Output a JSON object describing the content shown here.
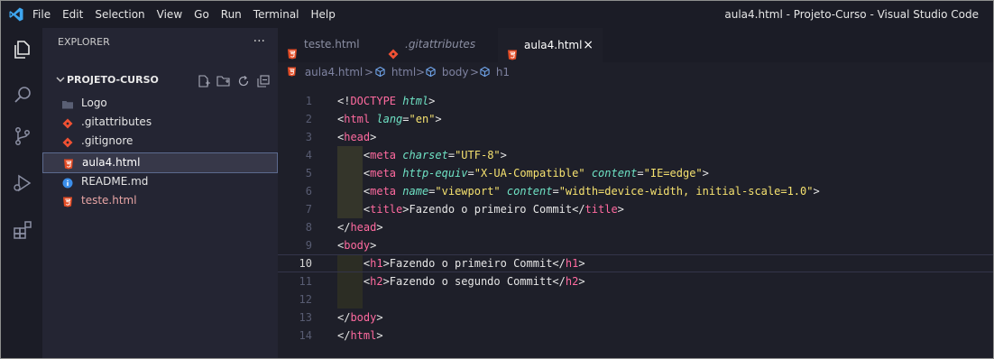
{
  "menu": [
    "File",
    "Edit",
    "Selection",
    "View",
    "Go",
    "Run",
    "Terminal",
    "Help"
  ],
  "window_title": "aula4.html - Projeto-Curso - Visual Studio Code",
  "explorer": {
    "title": "EXPLORER",
    "more": "···",
    "folder": "PROJETO-CURSO",
    "files": [
      {
        "name": "Logo",
        "icon": "folder-icon",
        "color": "#e6e6e6"
      },
      {
        "name": ".gitattributes",
        "icon": "git-icon",
        "color": "#e6e6e6"
      },
      {
        "name": ".gitignore",
        "icon": "git-icon",
        "color": "#e6e6e6"
      },
      {
        "name": "aula4.html",
        "icon": "html5-icon",
        "color": "#ffffff"
      },
      {
        "name": "README.md",
        "icon": "info-icon",
        "color": "#e6e6e6"
      },
      {
        "name": "teste.html",
        "icon": "html5-icon",
        "color": "#e8a5a5"
      }
    ]
  },
  "tabs": [
    {
      "label": "teste.html",
      "icon": "html5-icon"
    },
    {
      "label": ".gitattributes",
      "icon": "git-icon"
    },
    {
      "label": "aula4.html",
      "icon": "html5-icon",
      "close": "×",
      "active": true
    }
  ],
  "breadcrumb": [
    "aula4.html",
    "html",
    "body",
    "h1"
  ],
  "breadcrumb_sep": ">",
  "editor": {
    "current_line": 10,
    "line_numbers": [
      "1",
      "2",
      "3",
      "4",
      "5",
      "6",
      "7",
      "8",
      "9",
      "10",
      "11",
      "12",
      "13",
      "14"
    ]
  },
  "colors": {
    "tag": "#ff6a9f",
    "attribute": "#6fe3c5",
    "string": "#f5e16f",
    "html_icon": "#e44d26",
    "git_icon": "#f05133",
    "info_icon": "#3b8eea"
  }
}
